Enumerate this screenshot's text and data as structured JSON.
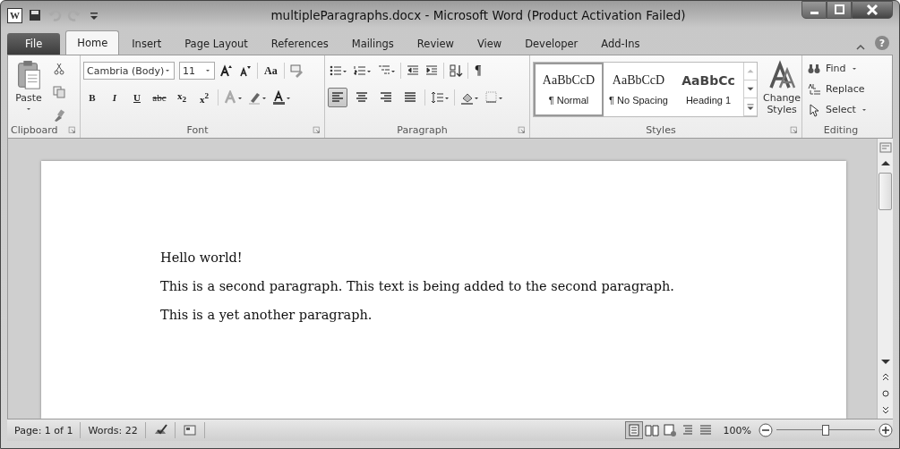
{
  "window": {
    "app_icon": "W",
    "title": "multipleParagraphs.docx - Microsoft Word (Product Activation Failed)",
    "help": "?"
  },
  "tabs": [
    {
      "label": "File",
      "kind": "file",
      "selected": false
    },
    {
      "label": "Home",
      "kind": "tab",
      "selected": true
    },
    {
      "label": "Insert",
      "kind": "tab",
      "selected": false
    },
    {
      "label": "Page Layout",
      "kind": "tab",
      "selected": false
    },
    {
      "label": "References",
      "kind": "tab",
      "selected": false
    },
    {
      "label": "Mailings",
      "kind": "tab",
      "selected": false
    },
    {
      "label": "Review",
      "kind": "tab",
      "selected": false
    },
    {
      "label": "View",
      "kind": "tab",
      "selected": false
    },
    {
      "label": "Developer",
      "kind": "tab",
      "selected": false
    },
    {
      "label": "Add-Ins",
      "kind": "tab",
      "selected": false
    }
  ],
  "ribbon": {
    "clipboard": {
      "label": "Clipboard",
      "paste": "Paste"
    },
    "font": {
      "label": "Font",
      "font_name": "Cambria (Body)",
      "font_size": "11",
      "change_case": "Aa",
      "format_buttons": [
        {
          "text": "B",
          "kind": "bold"
        },
        {
          "text": "I",
          "kind": "italic"
        },
        {
          "text": "U",
          "kind": "underline"
        },
        {
          "text": "abc",
          "kind": "strike"
        },
        {
          "text": "x$_{2}$",
          "kind": "plain"
        },
        {
          "text": "x$^{2}$",
          "kind": "plain"
        }
      ]
    },
    "paragraph": {
      "label": "Paragraph",
      "show_marks": "¶",
      "alignments": [
        {
          "selected": true
        },
        {
          "selected": false
        },
        {
          "selected": false
        },
        {
          "selected": false
        }
      ]
    },
    "styles": {
      "label": "Styles",
      "change_styles": "Change Styles",
      "gallery": [
        {
          "preview": "AaBbCcD",
          "name": "¶ Normal",
          "kind": "body",
          "selected": true
        },
        {
          "preview": "AaBbCcD",
          "name": "¶ No Spacing",
          "kind": "body",
          "selected": false
        },
        {
          "preview": "AaBbCc",
          "name": "Heading 1",
          "kind": "heading",
          "selected": false
        }
      ]
    },
    "editing": {
      "label": "Editing",
      "items": [
        {
          "label": "Find",
          "kind": "find",
          "dropdown": true
        },
        {
          "label": "Replace",
          "kind": "replace",
          "dropdown": false
        },
        {
          "label": "Select",
          "kind": "select",
          "dropdown": true
        }
      ]
    }
  },
  "document": {
    "paragraphs": [
      "Hello world!",
      "This is a second paragraph. This text is being added to the second paragraph.",
      "This is a yet another paragraph."
    ]
  },
  "status_bar": {
    "page": "Page: 1 of 1",
    "words": "Words: 22",
    "zoom": "100%",
    "views": [
      {
        "selected": true
      },
      {
        "selected": false
      },
      {
        "selected": false
      },
      {
        "selected": false
      },
      {
        "selected": false
      }
    ],
    "zoom_slider": {
      "level": 0.5
    }
  }
}
